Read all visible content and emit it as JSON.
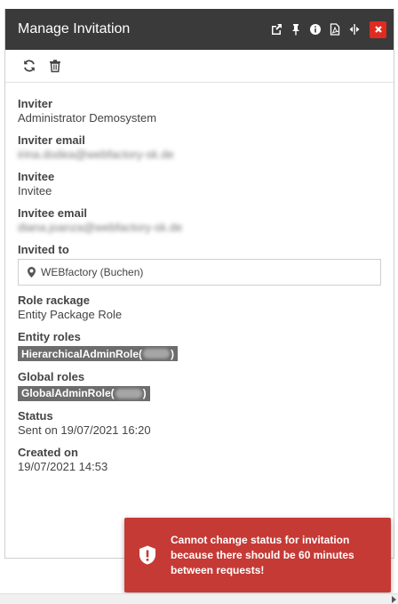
{
  "window": {
    "title": "Manage Invitation",
    "title_icons": [
      "popout-icon",
      "pin-icon",
      "info-icon",
      "pdf-icon",
      "resize-icon",
      "close-icon"
    ]
  },
  "toolbar": {
    "icons": [
      "refresh-icon",
      "trash-icon"
    ]
  },
  "fields": {
    "inviter": {
      "label": "Inviter",
      "value": "Administrator Demosystem"
    },
    "inviter_email": {
      "label": "Inviter email",
      "value": "irina.dodea@webfactory-sk.de"
    },
    "invitee": {
      "label": "Invitee",
      "value": "Invitee"
    },
    "invitee_email": {
      "label": "Invitee email",
      "value": "diana.joanza@webfactory-sk.de"
    },
    "invited_to": {
      "label": "Invited to",
      "value": "WEBfactory (Buchen)"
    },
    "role_package": {
      "label": "Role rackage",
      "value": "Entity Package Role"
    },
    "entity_roles": {
      "label": "Entity roles",
      "tag_prefix": "HierarchicalAdminRole(",
      "tag_suffix": ")"
    },
    "global_roles": {
      "label": "Global roles",
      "tag_prefix": "GlobalAdminRole(",
      "tag_suffix": ")"
    },
    "status": {
      "label": "Status",
      "value": "Sent on 19/07/2021 16:20"
    },
    "created_on": {
      "label": "Created on",
      "value": "19/07/2021 14:53"
    }
  },
  "toast": {
    "message": "Cannot change status for invitation because there should be 60 minutes between requests!",
    "color": "#c53a35"
  },
  "colors": {
    "titlebar": "#3a3a3a",
    "close": "#e02b20",
    "tag": "#6d6d6d"
  }
}
